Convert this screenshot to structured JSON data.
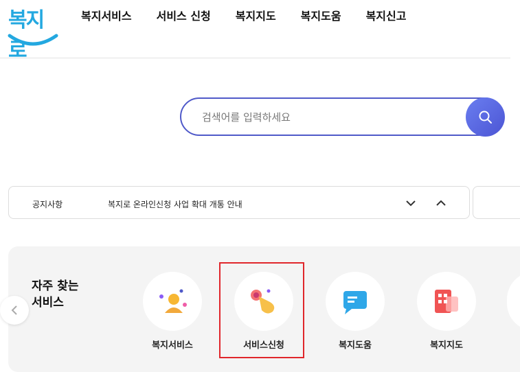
{
  "logo": {
    "text": "복지로"
  },
  "nav": {
    "items": [
      "복지서비스",
      "서비스 신청",
      "복지지도",
      "복지도움",
      "복지신고"
    ]
  },
  "search": {
    "placeholder": "검색어를 입력하세요"
  },
  "notice": {
    "label": "공지사항",
    "text": "복지로 온라인신청 사업 확대 개통 안내"
  },
  "services": {
    "title_line1": "자주 찾는",
    "title_line2": "서비스",
    "items": [
      {
        "label": "복지서비스",
        "icon": "person-icon"
      },
      {
        "label": "서비스신청",
        "icon": "hand-click-icon"
      },
      {
        "label": "복지도움",
        "icon": "chat-icon"
      },
      {
        "label": "복지지도",
        "icon": "map-icon"
      }
    ]
  },
  "colors": {
    "brand": "#23a8e0",
    "accent": "#4f59c9",
    "highlight": "#e0262b"
  }
}
